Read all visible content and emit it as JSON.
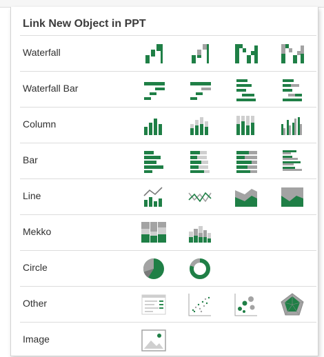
{
  "panel": {
    "title": "Link New Object in PPT"
  },
  "colors": {
    "accent_dark": "#1f7f46",
    "accent": "#2b8a50",
    "gray": "#a3a3a3",
    "light_gray": "#cfcfcf"
  },
  "rows": [
    {
      "label": "Waterfall",
      "icons": [
        "waterfall-icon",
        "waterfall-gap-icon",
        "waterfall-segmented-icon",
        "waterfall-segmented-gray-icon"
      ]
    },
    {
      "label": "Waterfall Bar",
      "icons": [
        "waterfall-bar-icon",
        "waterfall-bar-gray-icon",
        "waterfall-bar-stacked-icon",
        "waterfall-bar-stacked-gray-icon"
      ]
    },
    {
      "label": "Column",
      "icons": [
        "column-icon",
        "stacked-column-icon",
        "stacked-column-100-icon",
        "clustered-column-icon"
      ]
    },
    {
      "label": "Bar",
      "icons": [
        "bar-icon",
        "stacked-bar-icon",
        "stacked-bar-100-icon",
        "clustered-bar-icon"
      ]
    },
    {
      "label": "Line",
      "icons": [
        "line-column-icon",
        "line-icon",
        "area-icon",
        "area-100-icon"
      ]
    },
    {
      "label": "Mekko",
      "icons": [
        "mekko-icon",
        "mekko-bar-icon"
      ]
    },
    {
      "label": "Circle",
      "icons": [
        "pie-icon",
        "doughnut-icon"
      ]
    },
    {
      "label": "Other",
      "icons": [
        "table-icon",
        "scatter-icon",
        "bubble-icon",
        "radar-icon"
      ]
    },
    {
      "label": "Image",
      "icons": [
        "image-icon"
      ]
    }
  ]
}
